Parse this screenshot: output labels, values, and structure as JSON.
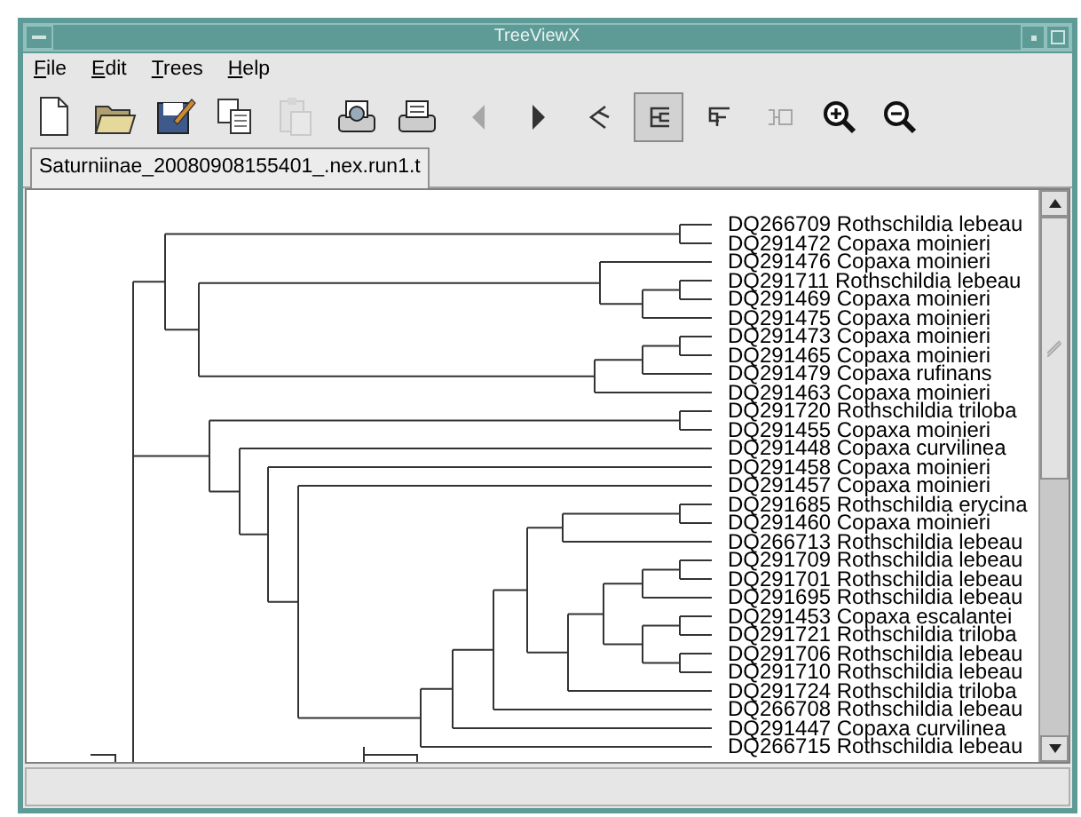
{
  "window": {
    "title": "TreeViewX"
  },
  "menu": [
    "File",
    "Edit",
    "Trees",
    "Help"
  ],
  "toolbar": [
    {
      "disabled": false
    },
    {
      "disabled": false
    },
    {
      "disabled": false
    },
    {
      "disabled": false
    },
    {
      "disabled": true
    },
    {
      "disabled": false
    },
    {
      "disabled": false
    },
    {
      "disabled": true
    },
    {
      "disabled": false
    },
    {
      "disabled": false,
      "selected": false
    },
    {
      "disabled": false,
      "selected": true
    },
    {
      "disabled": false,
      "selected": false
    },
    {
      "disabled": true
    },
    {
      "disabled": false
    },
    {
      "disabled": false
    }
  ],
  "tabs": [
    {
      "label": "Saturniinae_20080908155401_.nex.run1.t",
      "selected": true
    }
  ],
  "taxa": [
    "DQ266709 Rothschildia lebeau",
    "DQ291472 Copaxa moinieri",
    "DQ291476 Copaxa moinieri",
    "DQ291711 Rothschildia lebeau",
    "DQ291469 Copaxa moinieri",
    "DQ291475 Copaxa moinieri",
    "DQ291473 Copaxa moinieri",
    "DQ291465 Copaxa moinieri",
    "DQ291479 Copaxa rufinans",
    "DQ291463 Copaxa moinieri",
    "DQ291720 Rothschildia triloba",
    "DQ291455 Copaxa moinieri",
    "DQ291448 Copaxa curvilinea",
    "DQ291458 Copaxa moinieri",
    "DQ291457 Copaxa moinieri",
    "DQ291685 Rothschildia erycina",
    "DQ291460 Copaxa moinieri",
    "DQ266713 Rothschildia lebeau",
    "DQ291709 Rothschildia lebeau",
    "DQ291701 Rothschildia lebeau",
    "DQ291695 Rothschildia lebeau",
    "DQ291453 Copaxa escalantei",
    "DQ291721 Rothschildia triloba",
    "DQ291706 Rothschildia lebeau",
    "DQ291710 Rothschildia lebeau",
    "DQ291724 Rothschildia triloba",
    "DQ266708 Rothschildia lebeau",
    "DQ291447 Copaxa curvilinea",
    "DQ266715 Rothschildia lebeau"
  ]
}
